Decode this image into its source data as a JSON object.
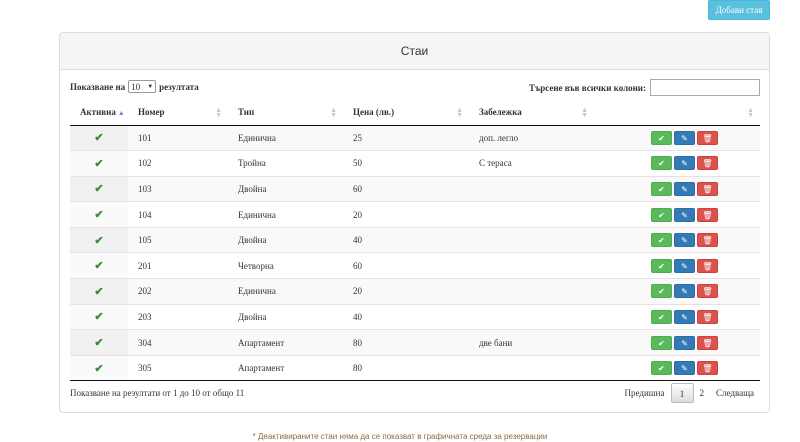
{
  "add_button": "Добави стая",
  "panel": {
    "title": "Стаи"
  },
  "length": {
    "prefix": "Показване на",
    "value": "10",
    "suffix": "резултата"
  },
  "search": {
    "label": "Търсене във всички колони:",
    "value": ""
  },
  "table": {
    "headers": [
      "Активна",
      "Номер",
      "Тип",
      "Цена (лв.)",
      "Забележка",
      ""
    ],
    "rows": [
      {
        "number": "101",
        "type": "Единична",
        "price": "25",
        "note": "доп. легло"
      },
      {
        "number": "102",
        "type": "Тройна",
        "price": "50",
        "note": "С тераса"
      },
      {
        "number": "103",
        "type": "Двойна",
        "price": "60",
        "note": ""
      },
      {
        "number": "104",
        "type": "Единична",
        "price": "20",
        "note": ""
      },
      {
        "number": "105",
        "type": "Двойна",
        "price": "40",
        "note": ""
      },
      {
        "number": "201",
        "type": "Четворна",
        "price": "60",
        "note": ""
      },
      {
        "number": "202",
        "type": "Единична",
        "price": "20",
        "note": ""
      },
      {
        "number": "203",
        "type": "Двойна",
        "price": "40",
        "note": ""
      },
      {
        "number": "304",
        "type": "Апартамент",
        "price": "80",
        "note": "две бани"
      },
      {
        "number": "305",
        "type": "Апартамент",
        "price": "80",
        "note": ""
      }
    ]
  },
  "info": "Показване на резултати от 1 до 10 от общо 11",
  "pagination": {
    "previous": "Предишна",
    "pages": [
      "1",
      "2"
    ],
    "current": "1",
    "next": "Следваща"
  },
  "footnote": "* Деактивираните стаи няма да се показват в графичната среда за резервации",
  "icons": {
    "active": "check-icon",
    "activate": "ok-icon",
    "edit": "pencil-icon",
    "delete": "trash-icon"
  }
}
